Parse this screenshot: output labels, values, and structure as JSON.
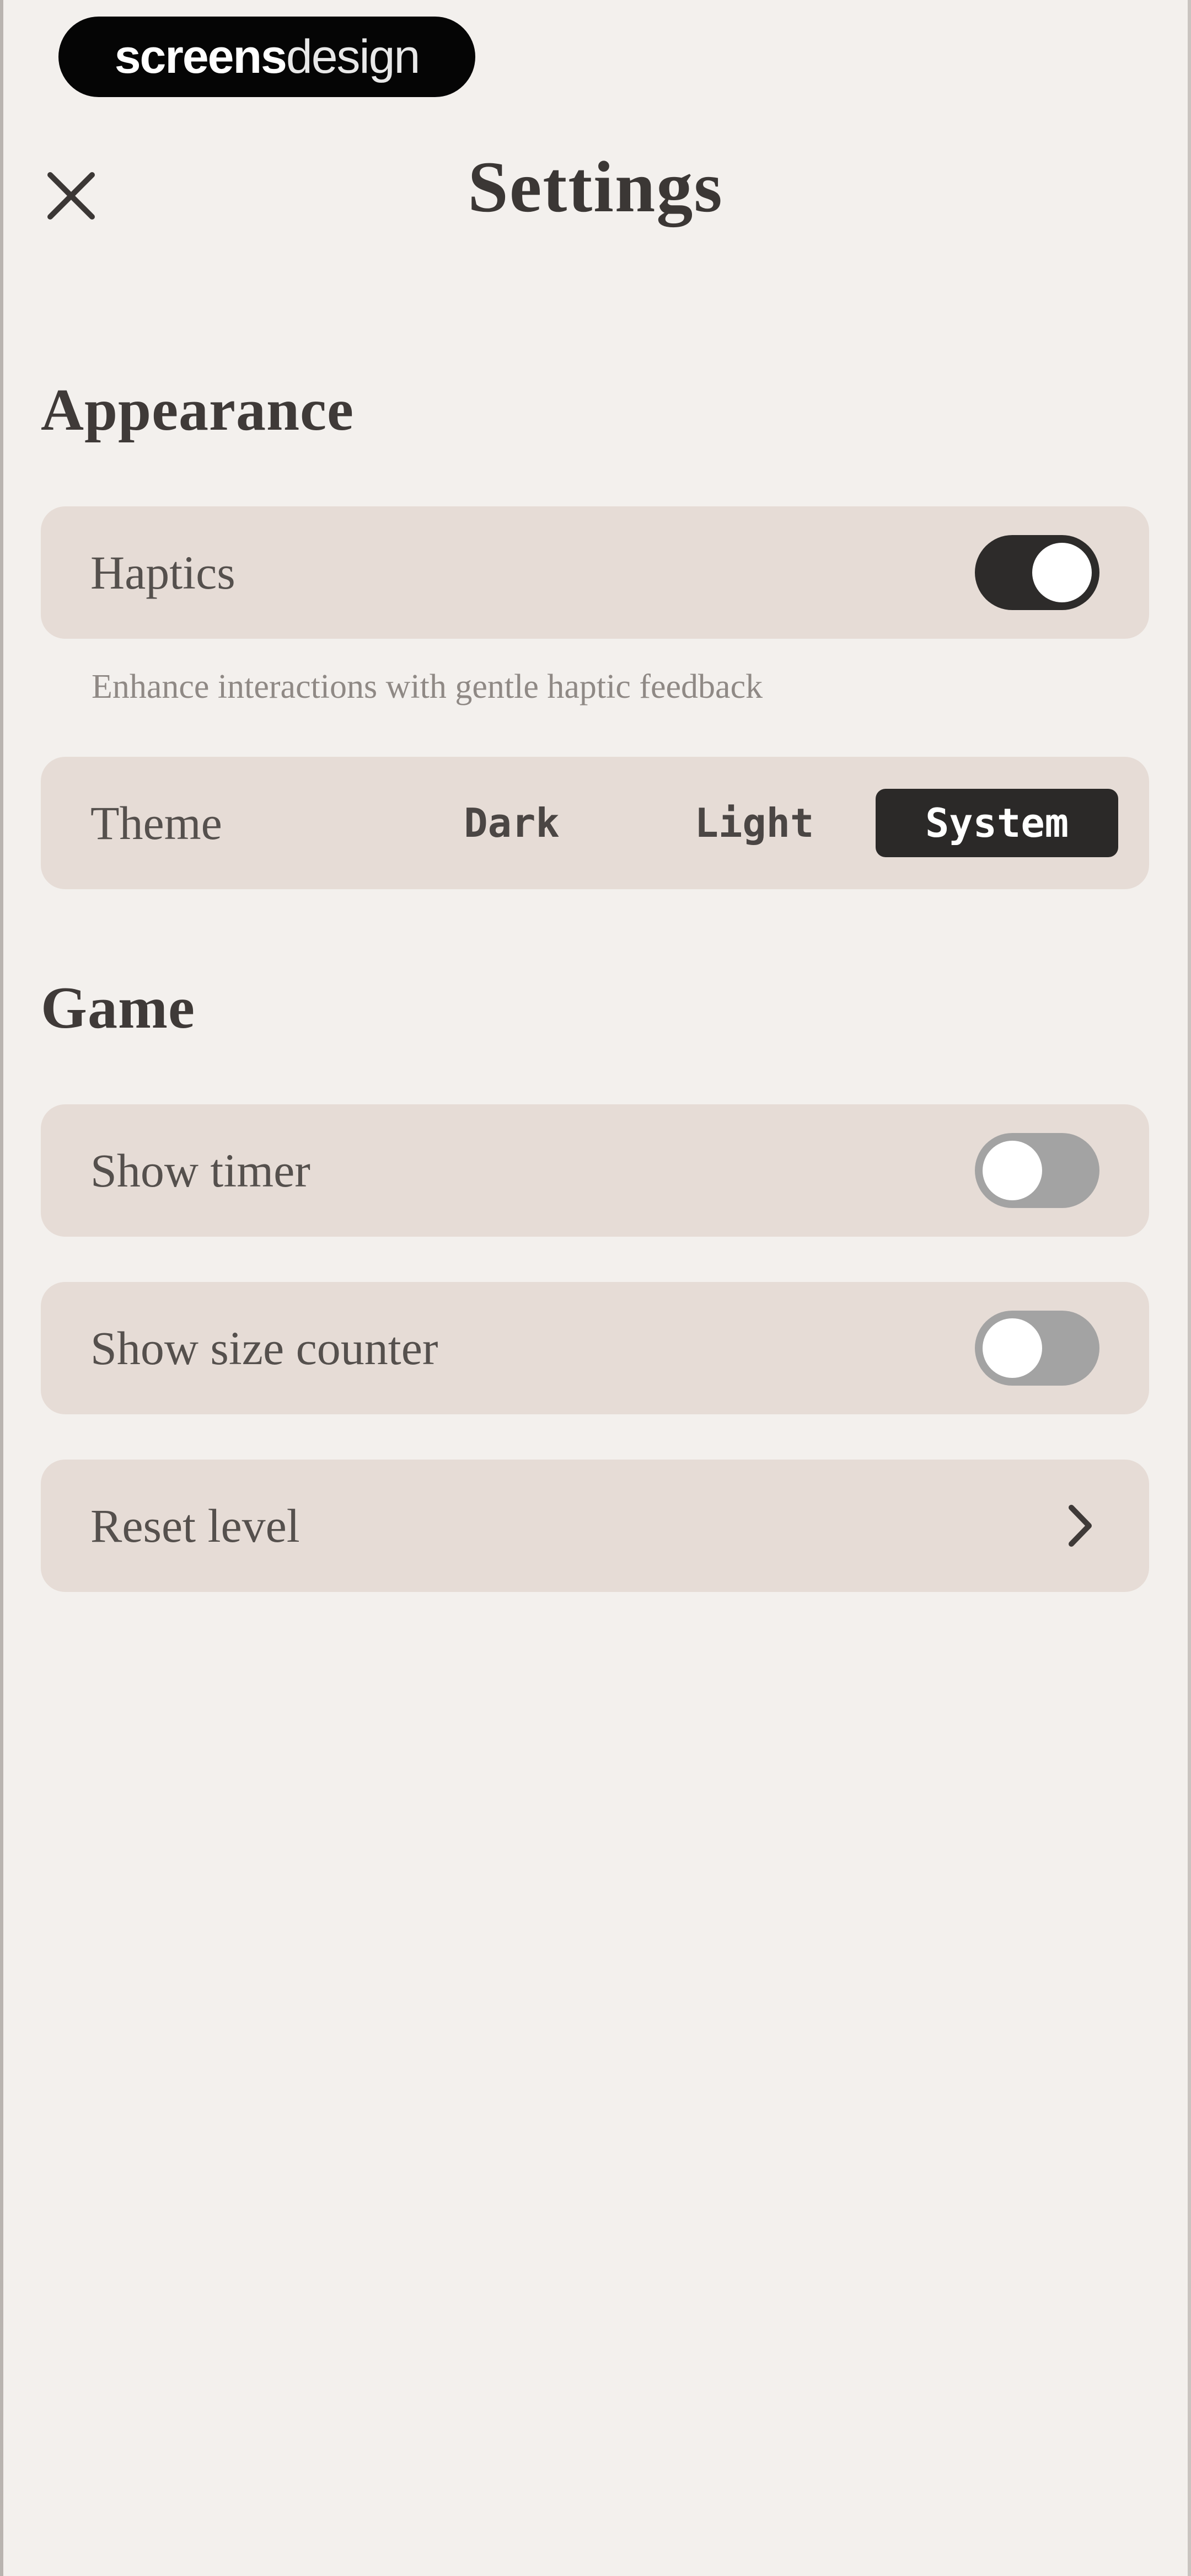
{
  "watermark": {
    "part1": "screens",
    "part2": "design"
  },
  "header": {
    "title": "Settings",
    "close_icon": "close-icon"
  },
  "appearance": {
    "title": "Appearance",
    "haptics": {
      "label": "Haptics",
      "enabled": true,
      "hint": "Enhance interactions with gentle haptic feedback"
    },
    "theme": {
      "label": "Theme",
      "options": [
        "Dark",
        "Light",
        "System"
      ],
      "selected": "System"
    }
  },
  "game": {
    "title": "Game",
    "show_timer": {
      "label": "Show timer",
      "enabled": false
    },
    "show_size_counter": {
      "label": "Show size counter",
      "enabled": false
    },
    "reset_level": {
      "label": "Reset level",
      "icon": "chevron-right-icon"
    }
  },
  "colors": {
    "background": "#f3f0ed",
    "row_background": "#e6dcd6",
    "toggle_on": "#2d2b2a",
    "toggle_off": "#a3a3a3",
    "segment_selected": "#2b2928"
  }
}
